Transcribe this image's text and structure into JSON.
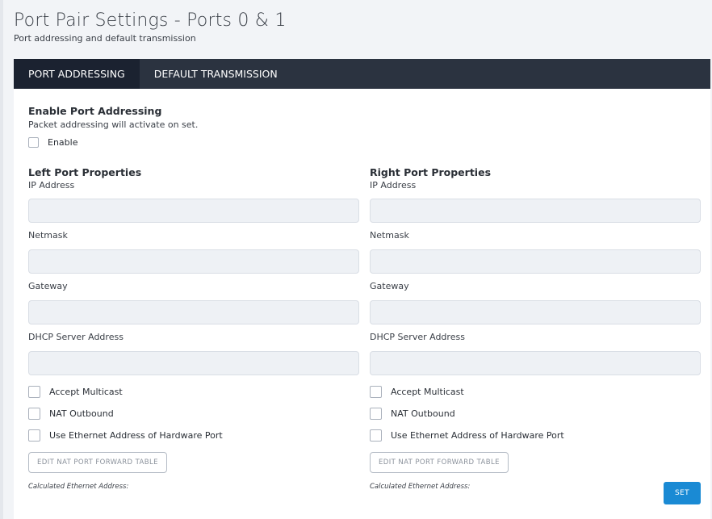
{
  "page": {
    "title": "Port Pair Settings - Ports 0 & 1",
    "subtitle": "Port addressing and default transmission"
  },
  "tabs": [
    {
      "label": "PORT ADDRESSING",
      "active": true
    },
    {
      "label": "DEFAULT TRANSMISSION",
      "active": false
    }
  ],
  "enable_section": {
    "title": "Enable Port Addressing",
    "description": "Packet addressing will activate on set.",
    "enable_label": "Enable",
    "enable_checked": false
  },
  "left": {
    "title": "Left Port Properties",
    "ip_label": "IP Address",
    "ip_value": "",
    "netmask_label": "Netmask",
    "netmask_value": "",
    "gateway_label": "Gateway",
    "gateway_value": "",
    "dhcp_label": "DHCP Server Address",
    "dhcp_value": "",
    "accept_multicast_label": "Accept Multicast",
    "nat_outbound_label": "NAT Outbound",
    "use_ethernet_label": "Use Ethernet Address of Hardware Port",
    "edit_nat_button": "EDIT NAT PORT FORWARD TABLE",
    "calculated_label": "Calculated Ethernet Address:"
  },
  "right": {
    "title": "Right Port Properties",
    "ip_label": "IP Address",
    "ip_value": "",
    "netmask_label": "Netmask",
    "netmask_value": "",
    "gateway_label": "Gateway",
    "gateway_value": "",
    "dhcp_label": "DHCP Server Address",
    "dhcp_value": "",
    "accept_multicast_label": "Accept Multicast",
    "nat_outbound_label": "NAT Outbound",
    "use_ethernet_label": "Use Ethernet Address of Hardware Port",
    "edit_nat_button": "EDIT NAT PORT FORWARD TABLE",
    "calculated_label": "Calculated Ethernet Address:"
  },
  "actions": {
    "set_label": "SET"
  },
  "colors": {
    "tab_bar": "#2b3340",
    "tab_active": "#1b2230",
    "primary": "#1a8ad4",
    "input_bg": "#eef1f5"
  }
}
